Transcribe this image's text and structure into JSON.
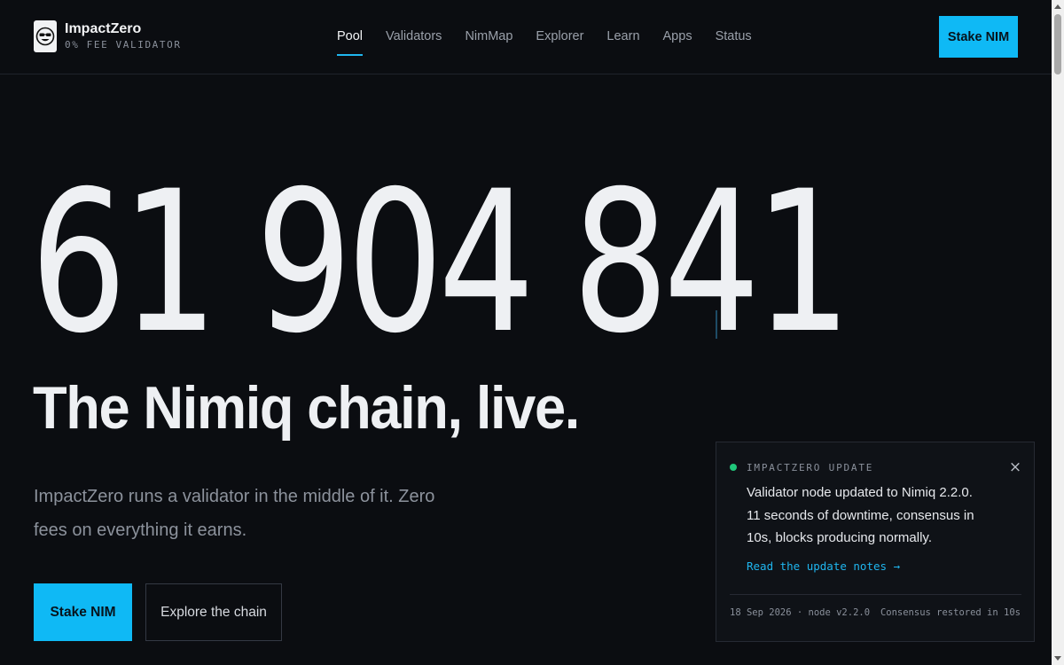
{
  "brand": {
    "name": "ImpactZero",
    "tagline": "0% FEE VALIDATOR"
  },
  "nav": {
    "items": [
      {
        "label": "Pool",
        "active": true
      },
      {
        "label": "Validators",
        "active": false
      },
      {
        "label": "NimMap",
        "active": false
      },
      {
        "label": "Explorer",
        "active": false
      },
      {
        "label": "Learn",
        "active": false
      },
      {
        "label": "Apps",
        "active": false
      },
      {
        "label": "Status",
        "active": false
      }
    ],
    "cta_label": "Stake NIM"
  },
  "hero": {
    "counter": "61 904 841",
    "headline": "The Nimiq chain, live.",
    "subtitle": "ImpactZero runs a validator in the middle of it. Zero fees on everything it earns.",
    "primary_button": "Stake NIM",
    "secondary_button": "Explore the chain"
  },
  "toast": {
    "label": "IMPACTZERO UPDATE",
    "message": "Validator node updated to Nimiq 2.2.0. 11 seconds of downtime, consensus in 10s, blocks producing normally.",
    "link": "Read the update notes →",
    "meta": "18 Sep 2026 · node v2.2.0",
    "status": "Consensus restored in 10s",
    "close_glyph": "×"
  },
  "colors": {
    "background": "#0b0d11",
    "accent": "#0fb9f5",
    "status_ok": "#20c77b"
  }
}
